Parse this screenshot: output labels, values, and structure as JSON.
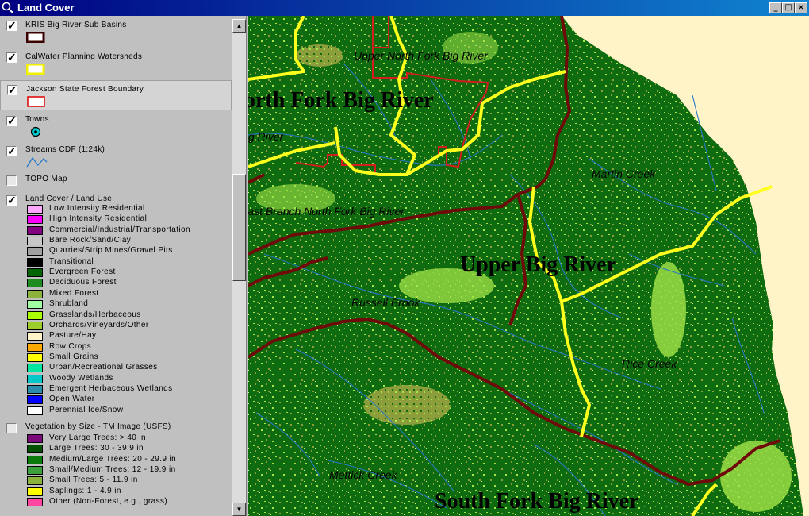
{
  "window": {
    "title": "Land Cover",
    "buttons": [
      "_",
      "□",
      "×"
    ]
  },
  "toc": {
    "layers": [
      {
        "name": "KRIS Big River Sub Basins",
        "checked": true,
        "symbol": "box",
        "fill": "#3a0000",
        "stroke": "#000000"
      },
      {
        "name": "CalWater Planning Watersheds",
        "checked": true,
        "symbol": "box",
        "fill": "#ffffff",
        "stroke": "#f0f000"
      },
      {
        "name": "Jackson State Forest Boundary",
        "checked": true,
        "symbol": "box",
        "fill": "#ffffff",
        "stroke": "#e00000"
      },
      {
        "name": "Towns",
        "checked": true,
        "symbol": "point"
      },
      {
        "name": "Streams CDF (1:24k)",
        "checked": true,
        "symbol": "line"
      },
      {
        "name": "TOPO Map",
        "checked": false,
        "symbol": "none"
      },
      {
        "name": "Land Cover / Land Use",
        "checked": true,
        "symbol": "none"
      },
      {
        "name": "Vegetation by Size - TM Image (USFS)",
        "checked": false,
        "symbol": "none"
      }
    ],
    "land_cover_legend": [
      {
        "label": "Low Intensity Residential",
        "color": "#ffa6ff"
      },
      {
        "label": "High Intensity Residential",
        "color": "#ff00ff"
      },
      {
        "label": "Commercial/Industrial/Transportation",
        "color": "#800080"
      },
      {
        "label": "Bare Rock/Sand/Clay",
        "color": "#c8c8c8"
      },
      {
        "label": "Quarries/Strip Mines/Gravel Pits",
        "color": "#a0a0a0"
      },
      {
        "label": "Transitional",
        "color": "#000000"
      },
      {
        "label": "Evergreen Forest",
        "color": "#006400"
      },
      {
        "label": "Deciduous Forest",
        "color": "#1e8c1e"
      },
      {
        "label": "Mixed Forest",
        "color": "#8cb43c"
      },
      {
        "label": "Shrubland",
        "color": "#a0ffa0"
      },
      {
        "label": "Grasslands/Herbaceous",
        "color": "#aaff00"
      },
      {
        "label": "Orchards/Vineyards/Other",
        "color": "#9ccd28"
      },
      {
        "label": "Pasture/Hay",
        "color": "#fff5c8"
      },
      {
        "label": "Row Crops",
        "color": "#ffaa00"
      },
      {
        "label": "Small Grains",
        "color": "#ffff00"
      },
      {
        "label": "Urban/Recreational Grasses",
        "color": "#00e6a0"
      },
      {
        "label": "Woody Wetlands",
        "color": "#00c8c8"
      },
      {
        "label": "Emergent Herbaceous Wetlands",
        "color": "#288caa"
      },
      {
        "label": "Open Water",
        "color": "#0000ff"
      },
      {
        "label": "Perennial Ice/Snow",
        "color": "#ffffff"
      }
    ],
    "vegetation_legend": [
      {
        "label": "Very Large Trees: > 40  in",
        "color": "#7a0a7a"
      },
      {
        "label": "Large Trees: 30 - 39.9 in",
        "color": "#005000"
      },
      {
        "label": "Medium/Large Trees: 20 - 29.9 in",
        "color": "#0a7a0a"
      },
      {
        "label": "Small/Medium Trees: 12 - 19.9 in",
        "color": "#3ca03c"
      },
      {
        "label": "Small Trees: 5 - 11.9 in",
        "color": "#8cb43c"
      },
      {
        "label": "Saplings: 1 - 4.9 in",
        "color": "#ffff00"
      },
      {
        "label": "Other (Non-Forest, e.g., grass)",
        "color": "#ff46a0"
      }
    ]
  },
  "map": {
    "colors": {
      "forest": "#0f6b0f",
      "shrub": "#a4e64a",
      "mixed": "#8c9e3c",
      "pasture": "#fff3c8",
      "subbasin": "#6e0a0a",
      "watershed": "#ffff1e",
      "jackson": "#d21e1e",
      "stream": "#2878c8"
    },
    "labels": [
      {
        "id": "upper-north-fork",
        "text": "Upper North Fork Big River",
        "style": "italic"
      },
      {
        "id": "north-fork",
        "text": "orth Fork Big River",
        "style": "bold"
      },
      {
        "id": "big-river-left",
        "text": "g River",
        "style": "italic"
      },
      {
        "id": "martin-creek",
        "text": "Martin Creek",
        "style": "italic"
      },
      {
        "id": "east-branch",
        "text": "East Branch North Fork Big River",
        "style": "italic"
      },
      {
        "id": "upper-big-river",
        "text": "Upper Big River",
        "style": "bold"
      },
      {
        "id": "russell-brook",
        "text": "Russell Brook",
        "style": "italic"
      },
      {
        "id": "rice-creek",
        "text": "Rice Creek",
        "style": "italic"
      },
      {
        "id": "mettick-creek",
        "text": "Mettick Creek",
        "style": "italic"
      },
      {
        "id": "south-fork",
        "text": "South Fork Big River",
        "style": "bold"
      }
    ]
  }
}
